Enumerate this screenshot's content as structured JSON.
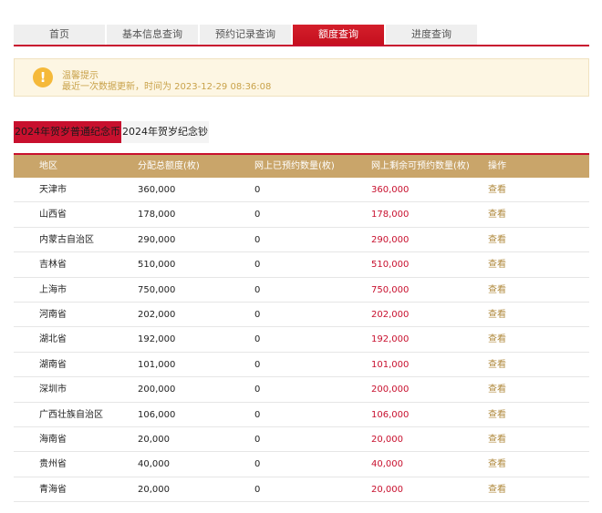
{
  "tabs": [
    "首页",
    "基本信息查询",
    "预约记录查询",
    "额度查询",
    "进度查询"
  ],
  "active_tab": 3,
  "notice": {
    "title": "温馨提示",
    "text": "最近一次数据更新，时间为 2023-12-29 08:36:08",
    "icon": "exclamation-icon"
  },
  "subtabs": [
    "2024年贺岁普通纪念币",
    "2024年贺岁纪念钞"
  ],
  "active_subtab": 0,
  "table": {
    "headers": [
      "地区",
      "分配总额度(枚)",
      "网上已预约数量(枚)",
      "网上剩余可预约数量(枚)",
      "操作"
    ],
    "rows": [
      {
        "region": "天津市",
        "total": "360,000",
        "booked": "0",
        "remaining": "360,000",
        "action": "查看"
      },
      {
        "region": "山西省",
        "total": "178,000",
        "booked": "0",
        "remaining": "178,000",
        "action": "查看"
      },
      {
        "region": "内蒙古自治区",
        "total": "290,000",
        "booked": "0",
        "remaining": "290,000",
        "action": "查看"
      },
      {
        "region": "吉林省",
        "total": "510,000",
        "booked": "0",
        "remaining": "510,000",
        "action": "查看"
      },
      {
        "region": "上海市",
        "total": "750,000",
        "booked": "0",
        "remaining": "750,000",
        "action": "查看"
      },
      {
        "region": "河南省",
        "total": "202,000",
        "booked": "0",
        "remaining": "202,000",
        "action": "查看"
      },
      {
        "region": "湖北省",
        "total": "192,000",
        "booked": "0",
        "remaining": "192,000",
        "action": "查看"
      },
      {
        "region": "湖南省",
        "total": "101,000",
        "booked": "0",
        "remaining": "101,000",
        "action": "查看"
      },
      {
        "region": "深圳市",
        "total": "200,000",
        "booked": "0",
        "remaining": "200,000",
        "action": "查看"
      },
      {
        "region": "广西壮族自治区",
        "total": "106,000",
        "booked": "0",
        "remaining": "106,000",
        "action": "查看"
      },
      {
        "region": "海南省",
        "total": "20,000",
        "booked": "0",
        "remaining": "20,000",
        "action": "查看"
      },
      {
        "region": "贵州省",
        "total": "40,000",
        "booked": "0",
        "remaining": "40,000",
        "action": "查看"
      },
      {
        "region": "青海省",
        "total": "20,000",
        "booked": "0",
        "remaining": "20,000",
        "action": "查看"
      }
    ]
  },
  "colors": {
    "accent": "#c8102e",
    "header_bg": "#c9a56a",
    "notice_bg": "#fdf6e3",
    "link": "#b08a3e"
  }
}
